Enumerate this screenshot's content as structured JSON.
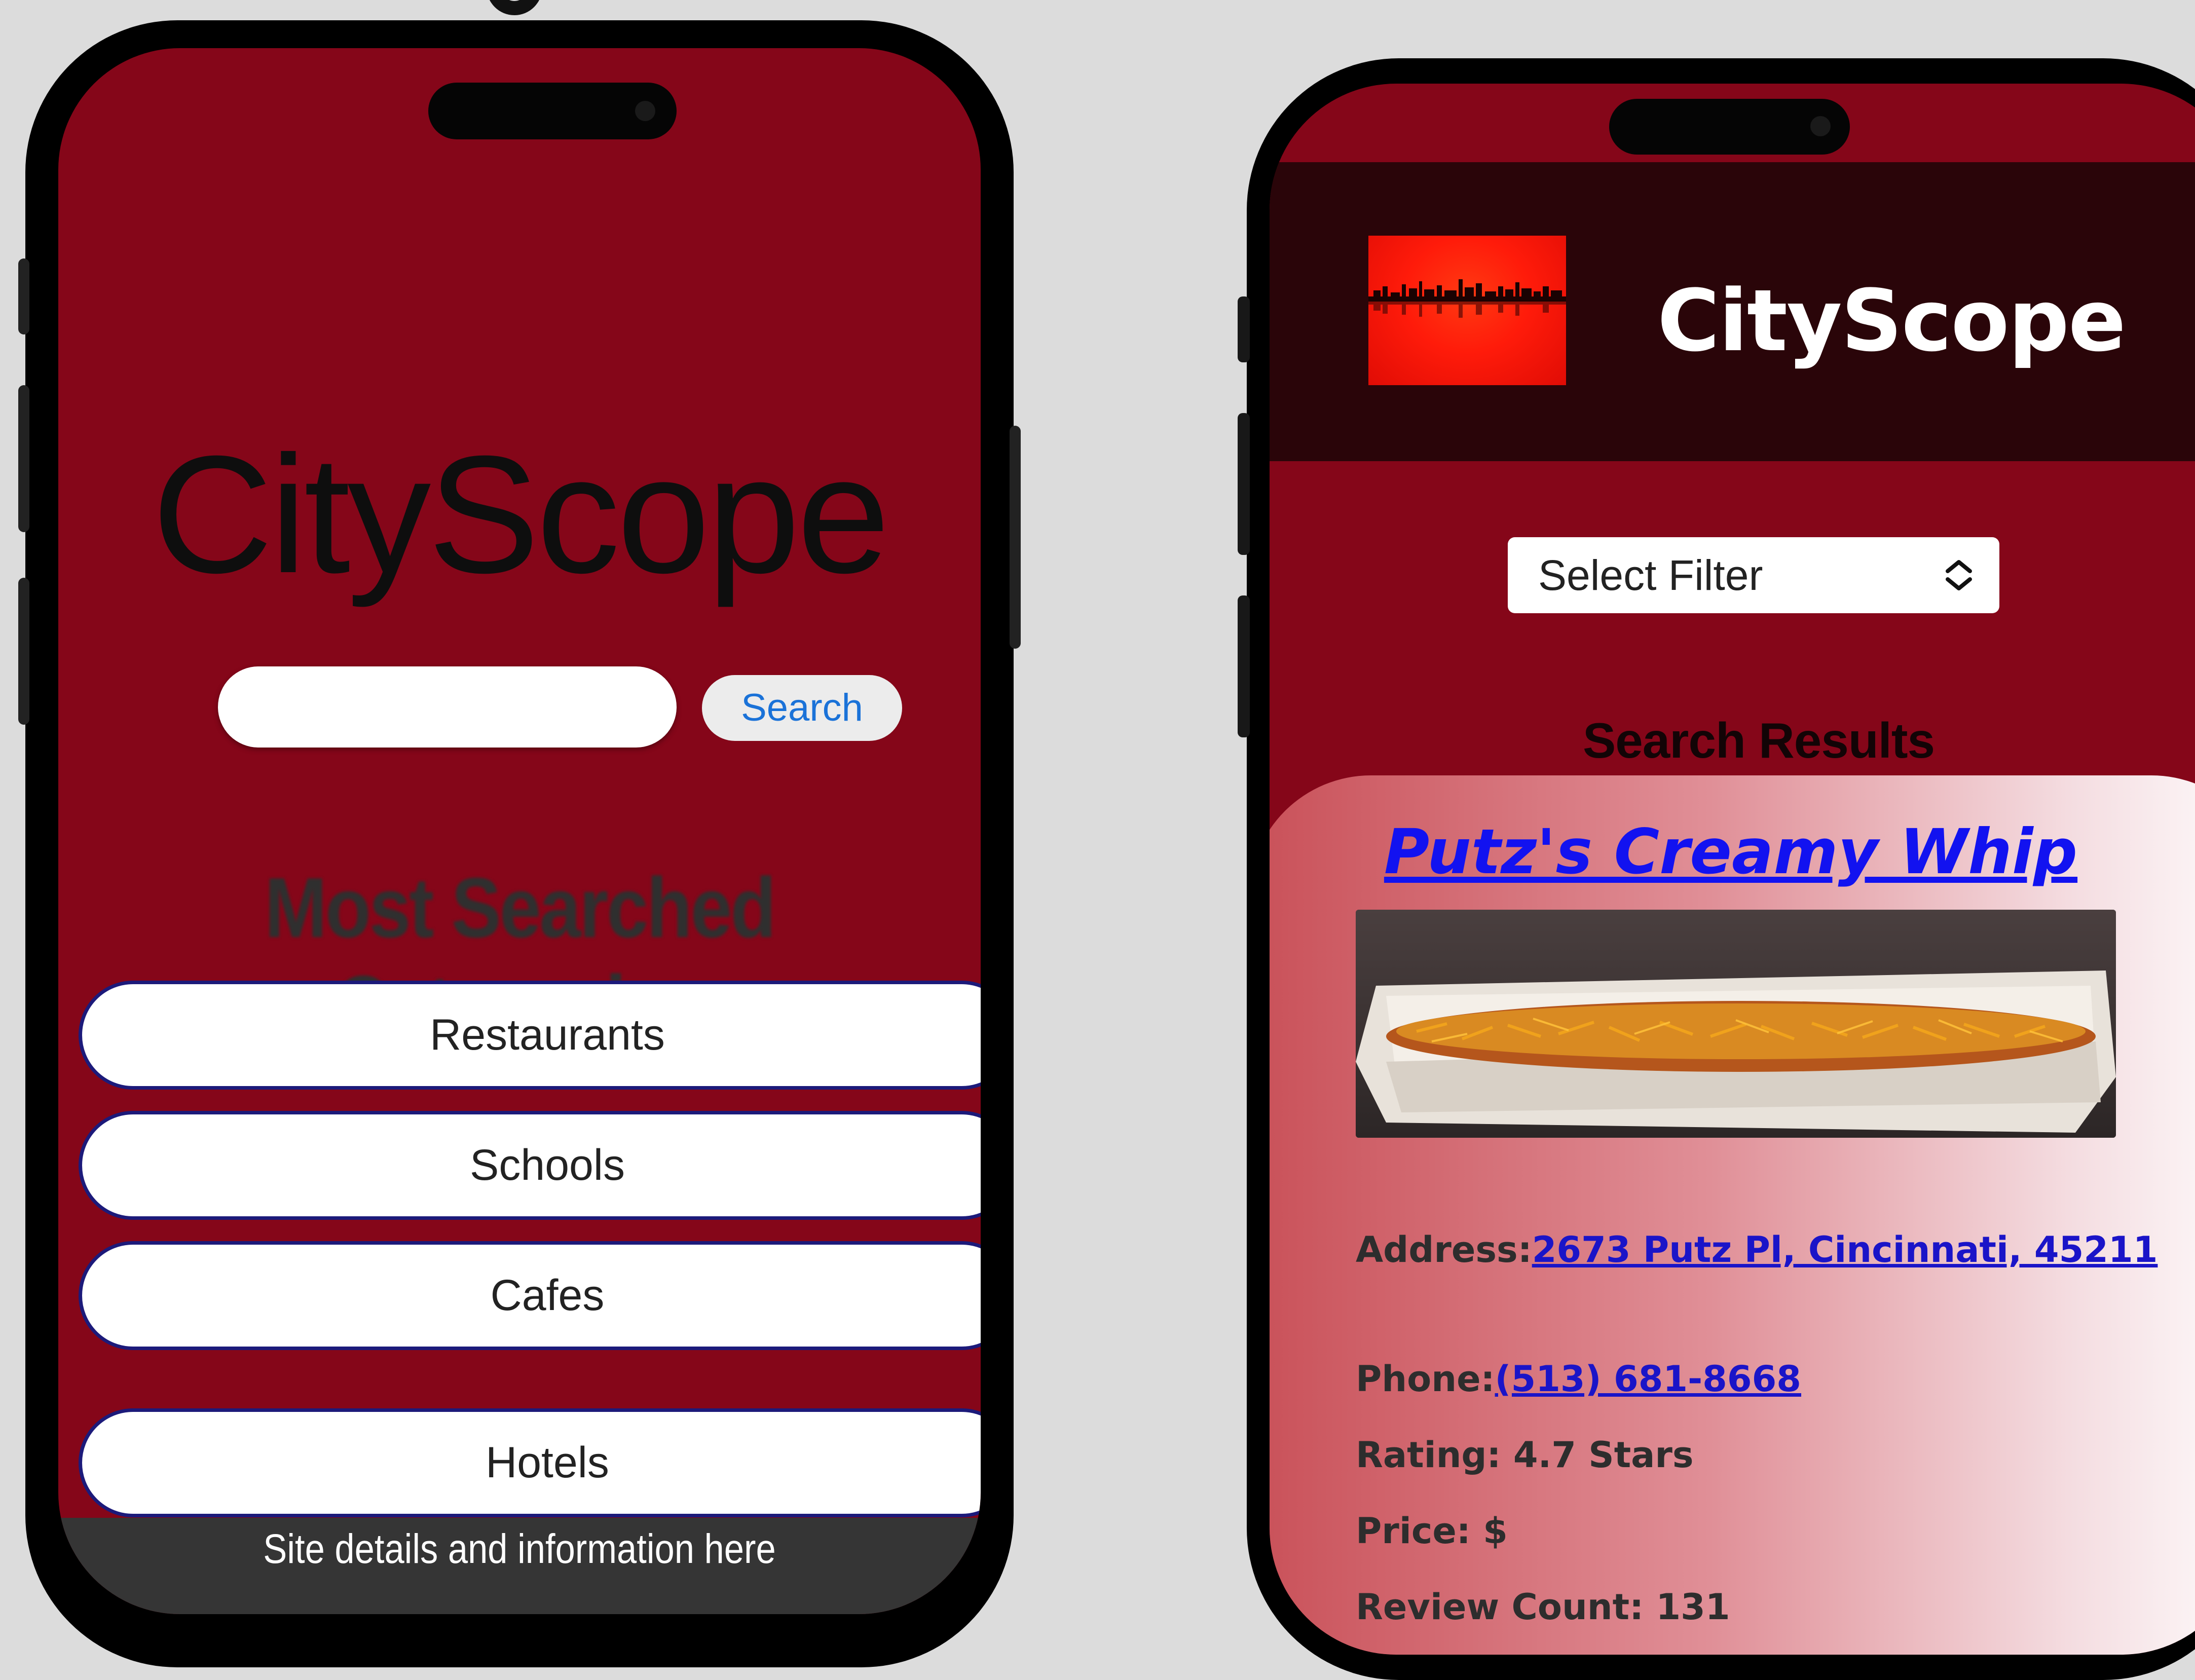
{
  "home_screen": {
    "logo_title": "CityScope",
    "search": {
      "input_value": "",
      "button_label": "Search"
    },
    "categories_heading": "Most Searched Categories",
    "categories": [
      "Restaurants",
      "Schools",
      "Cafes",
      "Hotels"
    ],
    "footer_text": "Site details and information here"
  },
  "results_screen": {
    "brand_name": "CityScope",
    "filter": {
      "selected": "Select Filter"
    },
    "results_heading": "Search Results",
    "result": {
      "name": "Putz's Creamy Whip",
      "address_label": "Address:",
      "address_value": "2673 Putz Pl, Cincinnati, 45211",
      "phone_label": "Phone:",
      "phone_value": "(513) 681-8668",
      "rating_text": "Rating: 4.7 Stars",
      "price_text": "Price: $",
      "review_count_text": "Review Count: 131"
    }
  },
  "colors": {
    "screen_bg": "#850619",
    "header_bg": "#2a0509",
    "link": "#1a14c8",
    "search_button_text": "#1a72d8"
  },
  "icons": {
    "select_chevrons": "chevron-up-down-icon",
    "brand_logo": "city-skyline-logo"
  }
}
